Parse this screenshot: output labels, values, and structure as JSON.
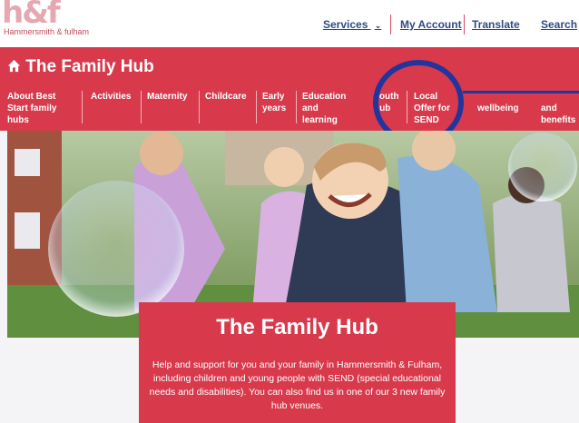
{
  "brand": {
    "mark": "h&f",
    "sub": "Hammersmith & fulham"
  },
  "top_nav": {
    "services": "Services",
    "account": "My Account",
    "translate": "Translate",
    "search": "Search"
  },
  "hub": {
    "title": "The Family Hub"
  },
  "nav": [
    "About Best Start family hubs",
    "Activities",
    "Maternity",
    "Childcare",
    "Early years",
    "Education and learning",
    "Youth hub",
    "Local Offer for SEND",
    "wellbeing",
    "and benefits"
  ],
  "card": {
    "title": "The Family Hub",
    "body": "Help and support for you and your family in Hammersmith & Fulham, including children and young people with SEND (special educational needs and disabilities). You can also find us in one of our 3 new family hub venues."
  }
}
